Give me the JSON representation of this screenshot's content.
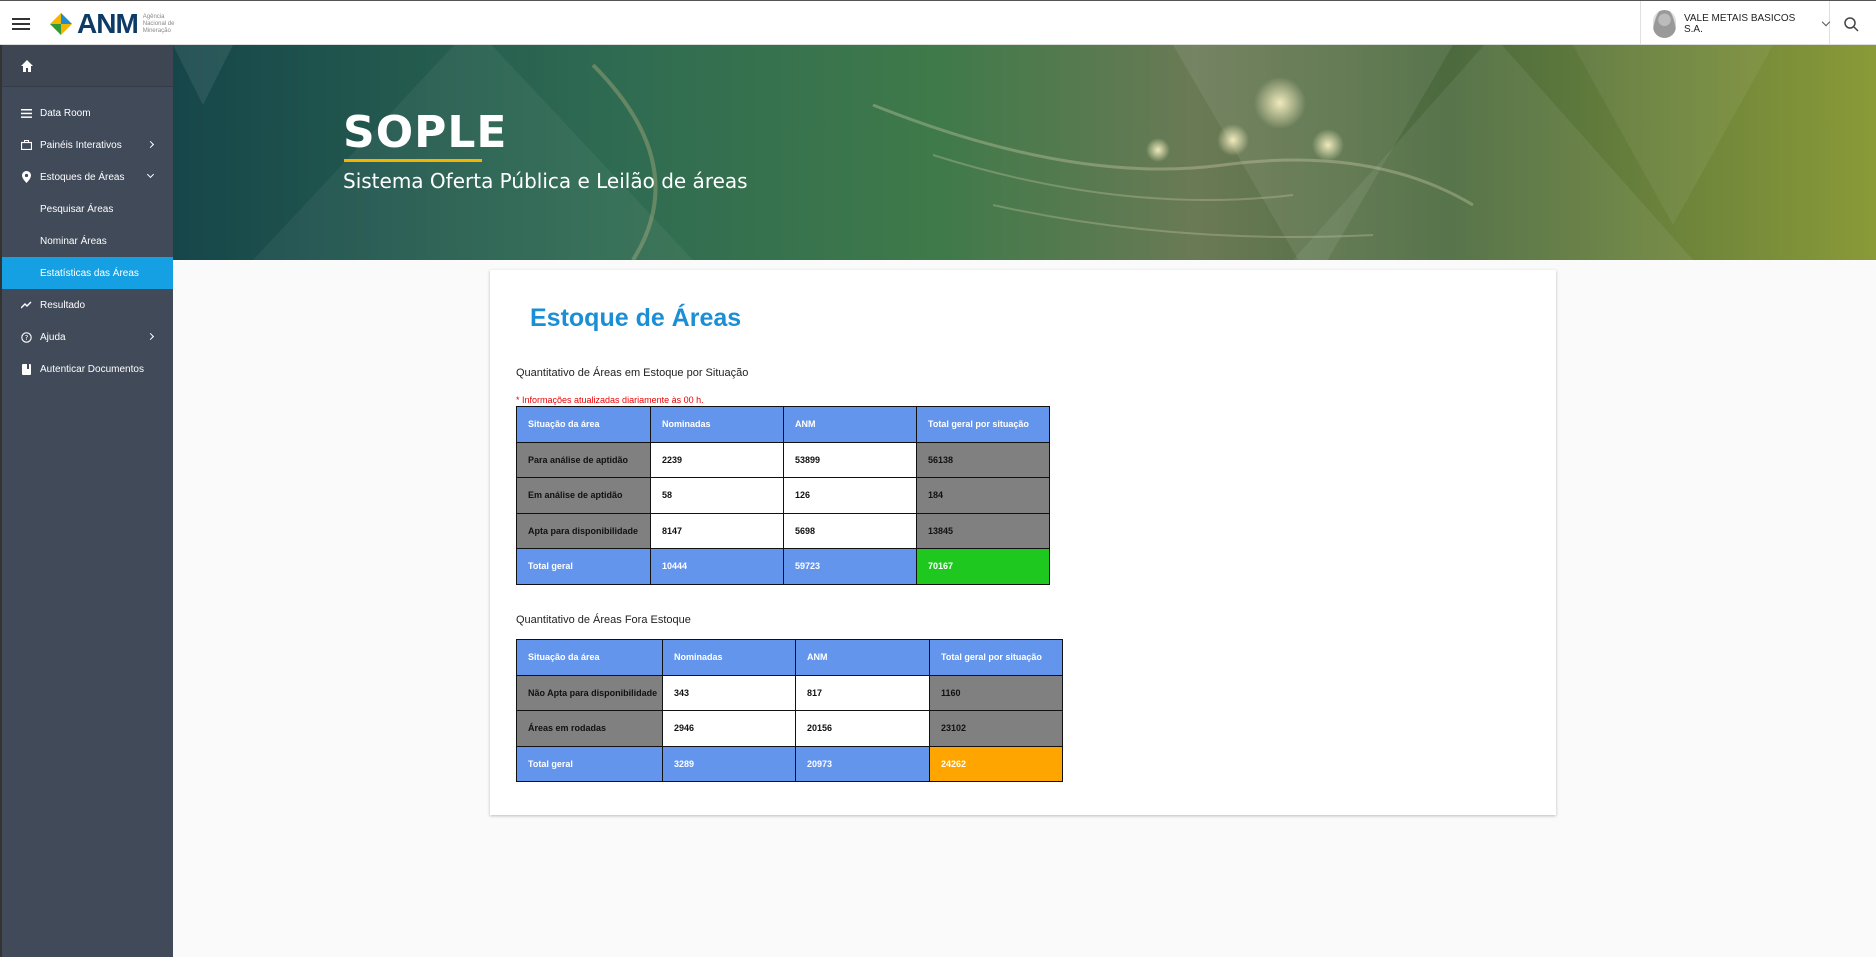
{
  "header": {
    "logo_text": "ANM",
    "logo_subtext": "Agência Nacional de Mineração",
    "user_name": "VALE METAIS BASICOS S.A."
  },
  "sidebar": {
    "items": [
      {
        "label": "Data Room",
        "icon": "list-icon"
      },
      {
        "label": "Painéis Interativos",
        "icon": "briefcase-icon"
      },
      {
        "label": "Estoques de Áreas",
        "icon": "location-pin-icon"
      },
      {
        "label": "Pesquisar Áreas"
      },
      {
        "label": "Nominar Áreas"
      },
      {
        "label": "Estatísticas das Áreas"
      },
      {
        "label": "Resultado",
        "icon": "trending-up-icon"
      },
      {
        "label": "Ajuda",
        "icon": "help-circle-icon"
      },
      {
        "label": "Autenticar Documentos",
        "icon": "book-icon"
      }
    ]
  },
  "banner": {
    "title": "SOPLE",
    "subtitle": "Sistema Oferta Pública e Leilão de áreas"
  },
  "page": {
    "title": "Estoque de Áreas",
    "section1_title": "Quantitativo de Áreas em Estoque por Situação",
    "note": "* Informações atualizadas diariamente às 00 h.",
    "section2_title": "Quantitativo de Áreas Fora Estoque"
  },
  "table1": {
    "headers": [
      "Situação da área",
      "Nominadas",
      "ANM",
      "Total geral por situação"
    ],
    "rows": [
      [
        "Para análise de aptidão",
        "2239",
        "53899",
        "56138"
      ],
      [
        "Em análise de aptidão",
        "58",
        "126",
        "184"
      ],
      [
        "Apta para disponibilidade",
        "8147",
        "5698",
        "13845"
      ]
    ],
    "total": [
      "Total geral",
      "10444",
      "59723",
      "70167"
    ]
  },
  "table2": {
    "headers": [
      "Situação da área",
      "Nominadas",
      "ANM",
      "Total geral por situação"
    ],
    "rows": [
      [
        "Não Apta para disponibilidade",
        "343",
        "817",
        "1160"
      ],
      [
        "Áreas em rodadas",
        "2946",
        "20156",
        "23102"
      ]
    ],
    "total": [
      "Total geral",
      "3289",
      "20973",
      "24262"
    ]
  },
  "colors": {
    "accent": "#14a0e3",
    "sidebar": "#414a59",
    "header_cell": "#6495ed",
    "grey_cell": "#808080",
    "total_green": "#1fc81f",
    "total_orange": "#ffa500",
    "title_blue": "#1a8fd6"
  }
}
